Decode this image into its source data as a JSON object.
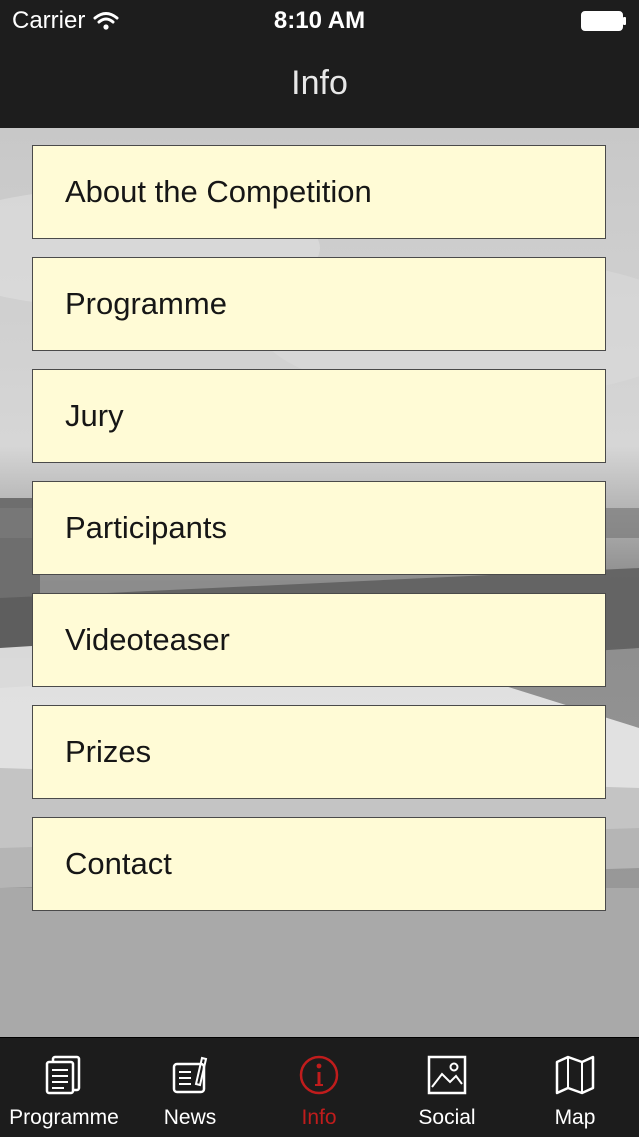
{
  "status_bar": {
    "carrier": "Carrier",
    "time": "8:10 AM",
    "icons": [
      "wifi-icon",
      "battery-icon"
    ]
  },
  "nav": {
    "title": "Info"
  },
  "menu": {
    "items": [
      {
        "label": "About the Competition"
      },
      {
        "label": "Programme"
      },
      {
        "label": "Jury"
      },
      {
        "label": "Participants"
      },
      {
        "label": "Videoteaser"
      },
      {
        "label": "Prizes"
      },
      {
        "label": "Contact"
      }
    ]
  },
  "tabbar": {
    "tabs": [
      {
        "label": "Programme",
        "icon": "document-list-icon",
        "active": false
      },
      {
        "label": "News",
        "icon": "newspaper-icon",
        "active": false
      },
      {
        "label": "Info",
        "icon": "info-icon",
        "active": true
      },
      {
        "label": "Social",
        "icon": "picture-icon",
        "active": false
      },
      {
        "label": "Map",
        "icon": "map-icon",
        "active": false
      }
    ]
  },
  "colors": {
    "bar_background": "#1d1d1d",
    "menu_item_background": "#fffbd6",
    "active_tab": "#c01c1c",
    "inactive_tab": "#ffffff"
  }
}
